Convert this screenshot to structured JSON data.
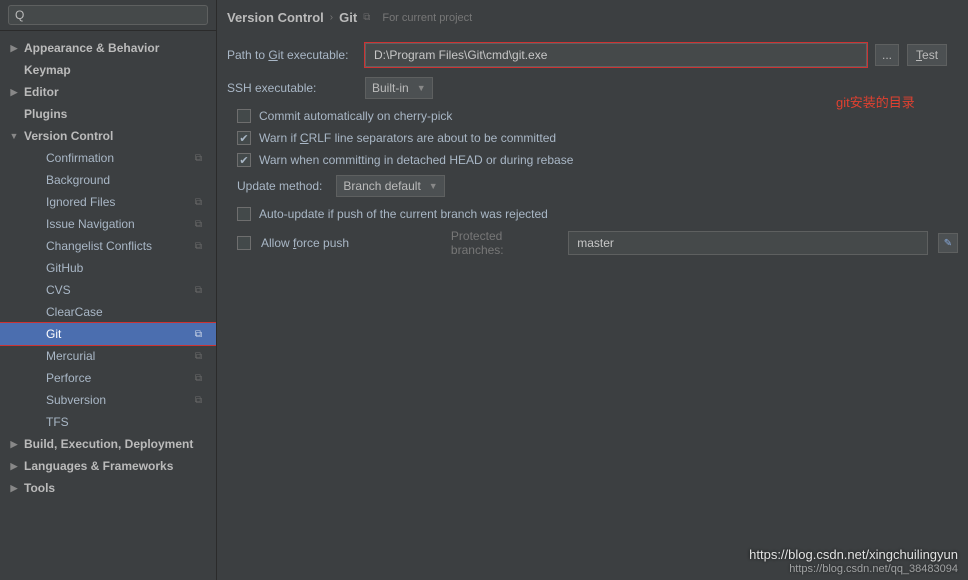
{
  "search": {
    "placeholder": ""
  },
  "sidebar": {
    "appearance": "Appearance & Behavior",
    "keymap": "Keymap",
    "editor": "Editor",
    "plugins": "Plugins",
    "version_control": "Version Control",
    "vc_children": {
      "confirmation": "Confirmation",
      "background": "Background",
      "ignored": "Ignored Files",
      "issue_nav": "Issue Navigation",
      "changelist": "Changelist Conflicts",
      "github": "GitHub",
      "cvs": "CVS",
      "clearcase": "ClearCase",
      "git": "Git",
      "mercurial": "Mercurial",
      "perforce": "Perforce",
      "subversion": "Subversion",
      "tfs": "TFS"
    },
    "build": "Build, Execution, Deployment",
    "languages": "Languages & Frameworks",
    "tools": "Tools"
  },
  "breadcrumb": {
    "root": "Version Control",
    "current": "Git",
    "hint": "For current project"
  },
  "form": {
    "path_label": "Path to Git executable:",
    "path_value": "D:\\Program Files\\Git\\cmd\\git.exe",
    "ellipsis": "...",
    "test": "Test",
    "ssh_label": "SSH executable:",
    "ssh_value": "Built-in",
    "commit_auto": "Commit automatically on cherry-pick",
    "warn_crlf": "Warn if CRLF line separators are about to be committed",
    "warn_detached": "Warn when committing in detached HEAD or during rebase",
    "update_label": "Update method:",
    "update_value": "Branch default",
    "auto_update": "Auto-update if push of the current branch was rejected",
    "allow_force": "Allow force push",
    "protected_label": "Protected branches:",
    "protected_value": "master"
  },
  "annotation": "git安装的目录",
  "watermark": {
    "line1": "https://blog.csdn.net/xingchuilingyun",
    "line2": "https://blog.csdn.net/qq_38483094"
  }
}
